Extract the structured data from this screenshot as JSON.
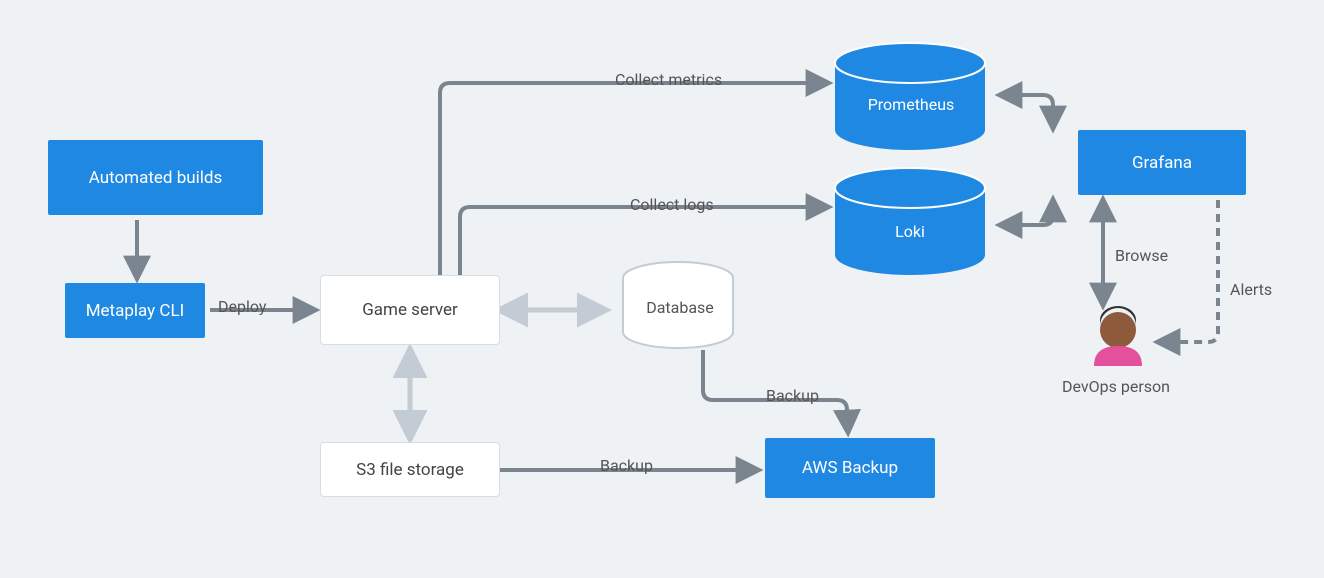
{
  "nodes": {
    "automated_builds": "Automated builds",
    "metaplay_cli": "Metaplay CLI",
    "game_server": "Game server",
    "database": "Database",
    "s3": "S3 file storage",
    "aws_backup": "AWS Backup",
    "prometheus": "Prometheus",
    "loki": "Loki",
    "grafana": "Grafana",
    "devops_person": "DevOps person"
  },
  "edges": {
    "deploy": "Deploy",
    "collect_metrics": "Collect metrics",
    "collect_logs": "Collect logs",
    "backup1": "Backup",
    "backup2": "Backup",
    "browse": "Browse",
    "alerts": "Alerts"
  },
  "colors": {
    "blue": "#1e88e2",
    "grey": "#7b8590",
    "light": "#c3ccd4"
  }
}
